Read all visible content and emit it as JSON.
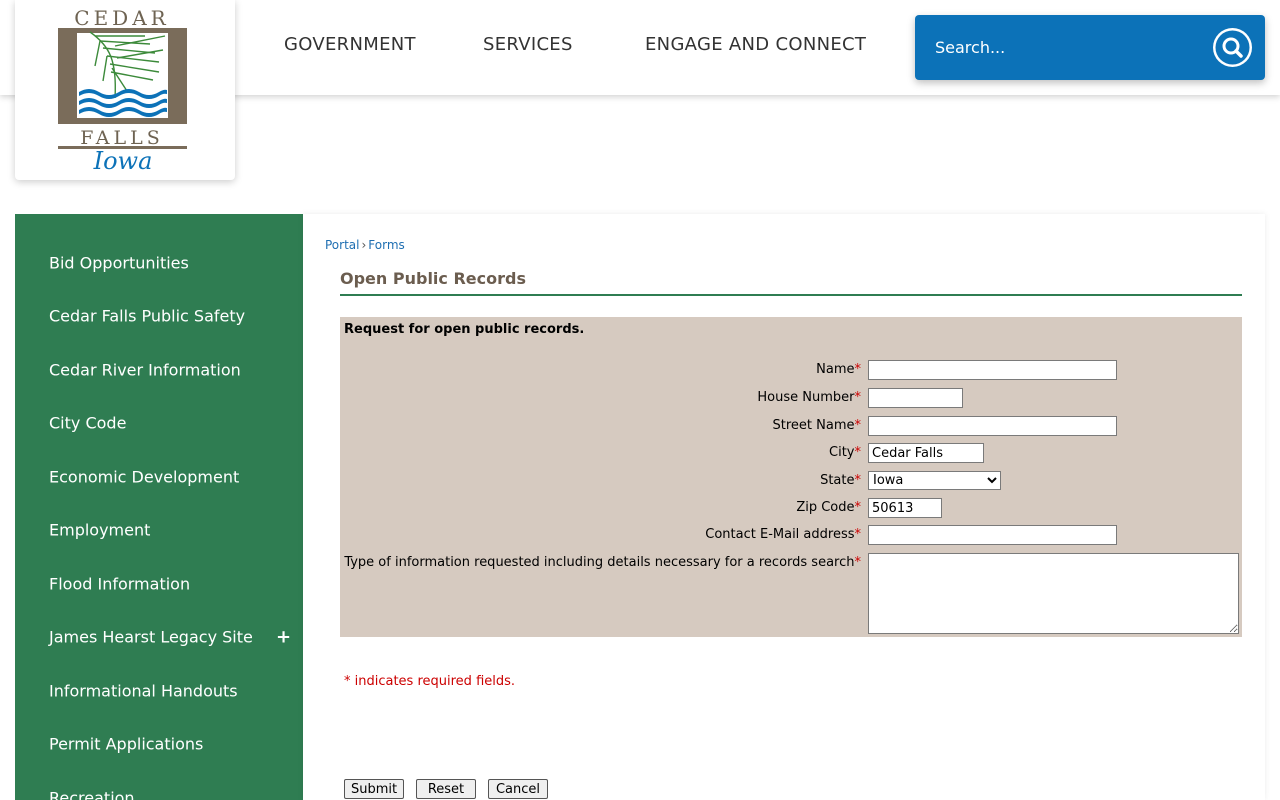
{
  "header": {
    "logo": {
      "top_text": "CEDAR",
      "middle_text": "FALLS",
      "script_text": "Iowa"
    },
    "nav": [
      "GOVERNMENT",
      "SERVICES",
      "ENGAGE AND CONNECT"
    ],
    "search": {
      "placeholder": "Search..."
    }
  },
  "sidebar": {
    "items": [
      {
        "label": "Bid Opportunities"
      },
      {
        "label": "Cedar Falls Public Safety"
      },
      {
        "label": "Cedar River Information"
      },
      {
        "label": "City Code"
      },
      {
        "label": "Economic Development"
      },
      {
        "label": "Employment"
      },
      {
        "label": "Flood Information"
      },
      {
        "label": "James Hearst Legacy Site",
        "expand": "+"
      },
      {
        "label": "Informational Handouts"
      },
      {
        "label": "Permit Applications"
      },
      {
        "label": "Recreation"
      }
    ]
  },
  "breadcrumb": {
    "portal": "Portal",
    "separator": "›",
    "forms": "Forms"
  },
  "page_title": "Open Public Records",
  "form": {
    "heading": "Request for open public records.",
    "required_marker": "*",
    "fields": {
      "name": {
        "label": "Name",
        "value": ""
      },
      "house_number": {
        "label": "House Number",
        "value": ""
      },
      "street_name": {
        "label": "Street Name",
        "value": ""
      },
      "city": {
        "label": "City",
        "value": "Cedar Falls"
      },
      "state": {
        "label": "State",
        "value": "Iowa"
      },
      "zip_code": {
        "label": "Zip Code",
        "value": "50613"
      },
      "email": {
        "label": "Contact E-Mail address",
        "value": ""
      },
      "details": {
        "label": "Type of information requested including details necessary for a records search",
        "value": ""
      }
    },
    "required_note": "* indicates required fields.",
    "buttons": {
      "submit": "Submit",
      "reset": "Reset",
      "cancel": "Cancel"
    }
  },
  "colors": {
    "sidebar_bg": "#2f7d52",
    "search_bg": "#0c72b8",
    "form_bg": "#d6cac0",
    "title_color": "#6b5d4f",
    "required_color": "#cc0000"
  }
}
